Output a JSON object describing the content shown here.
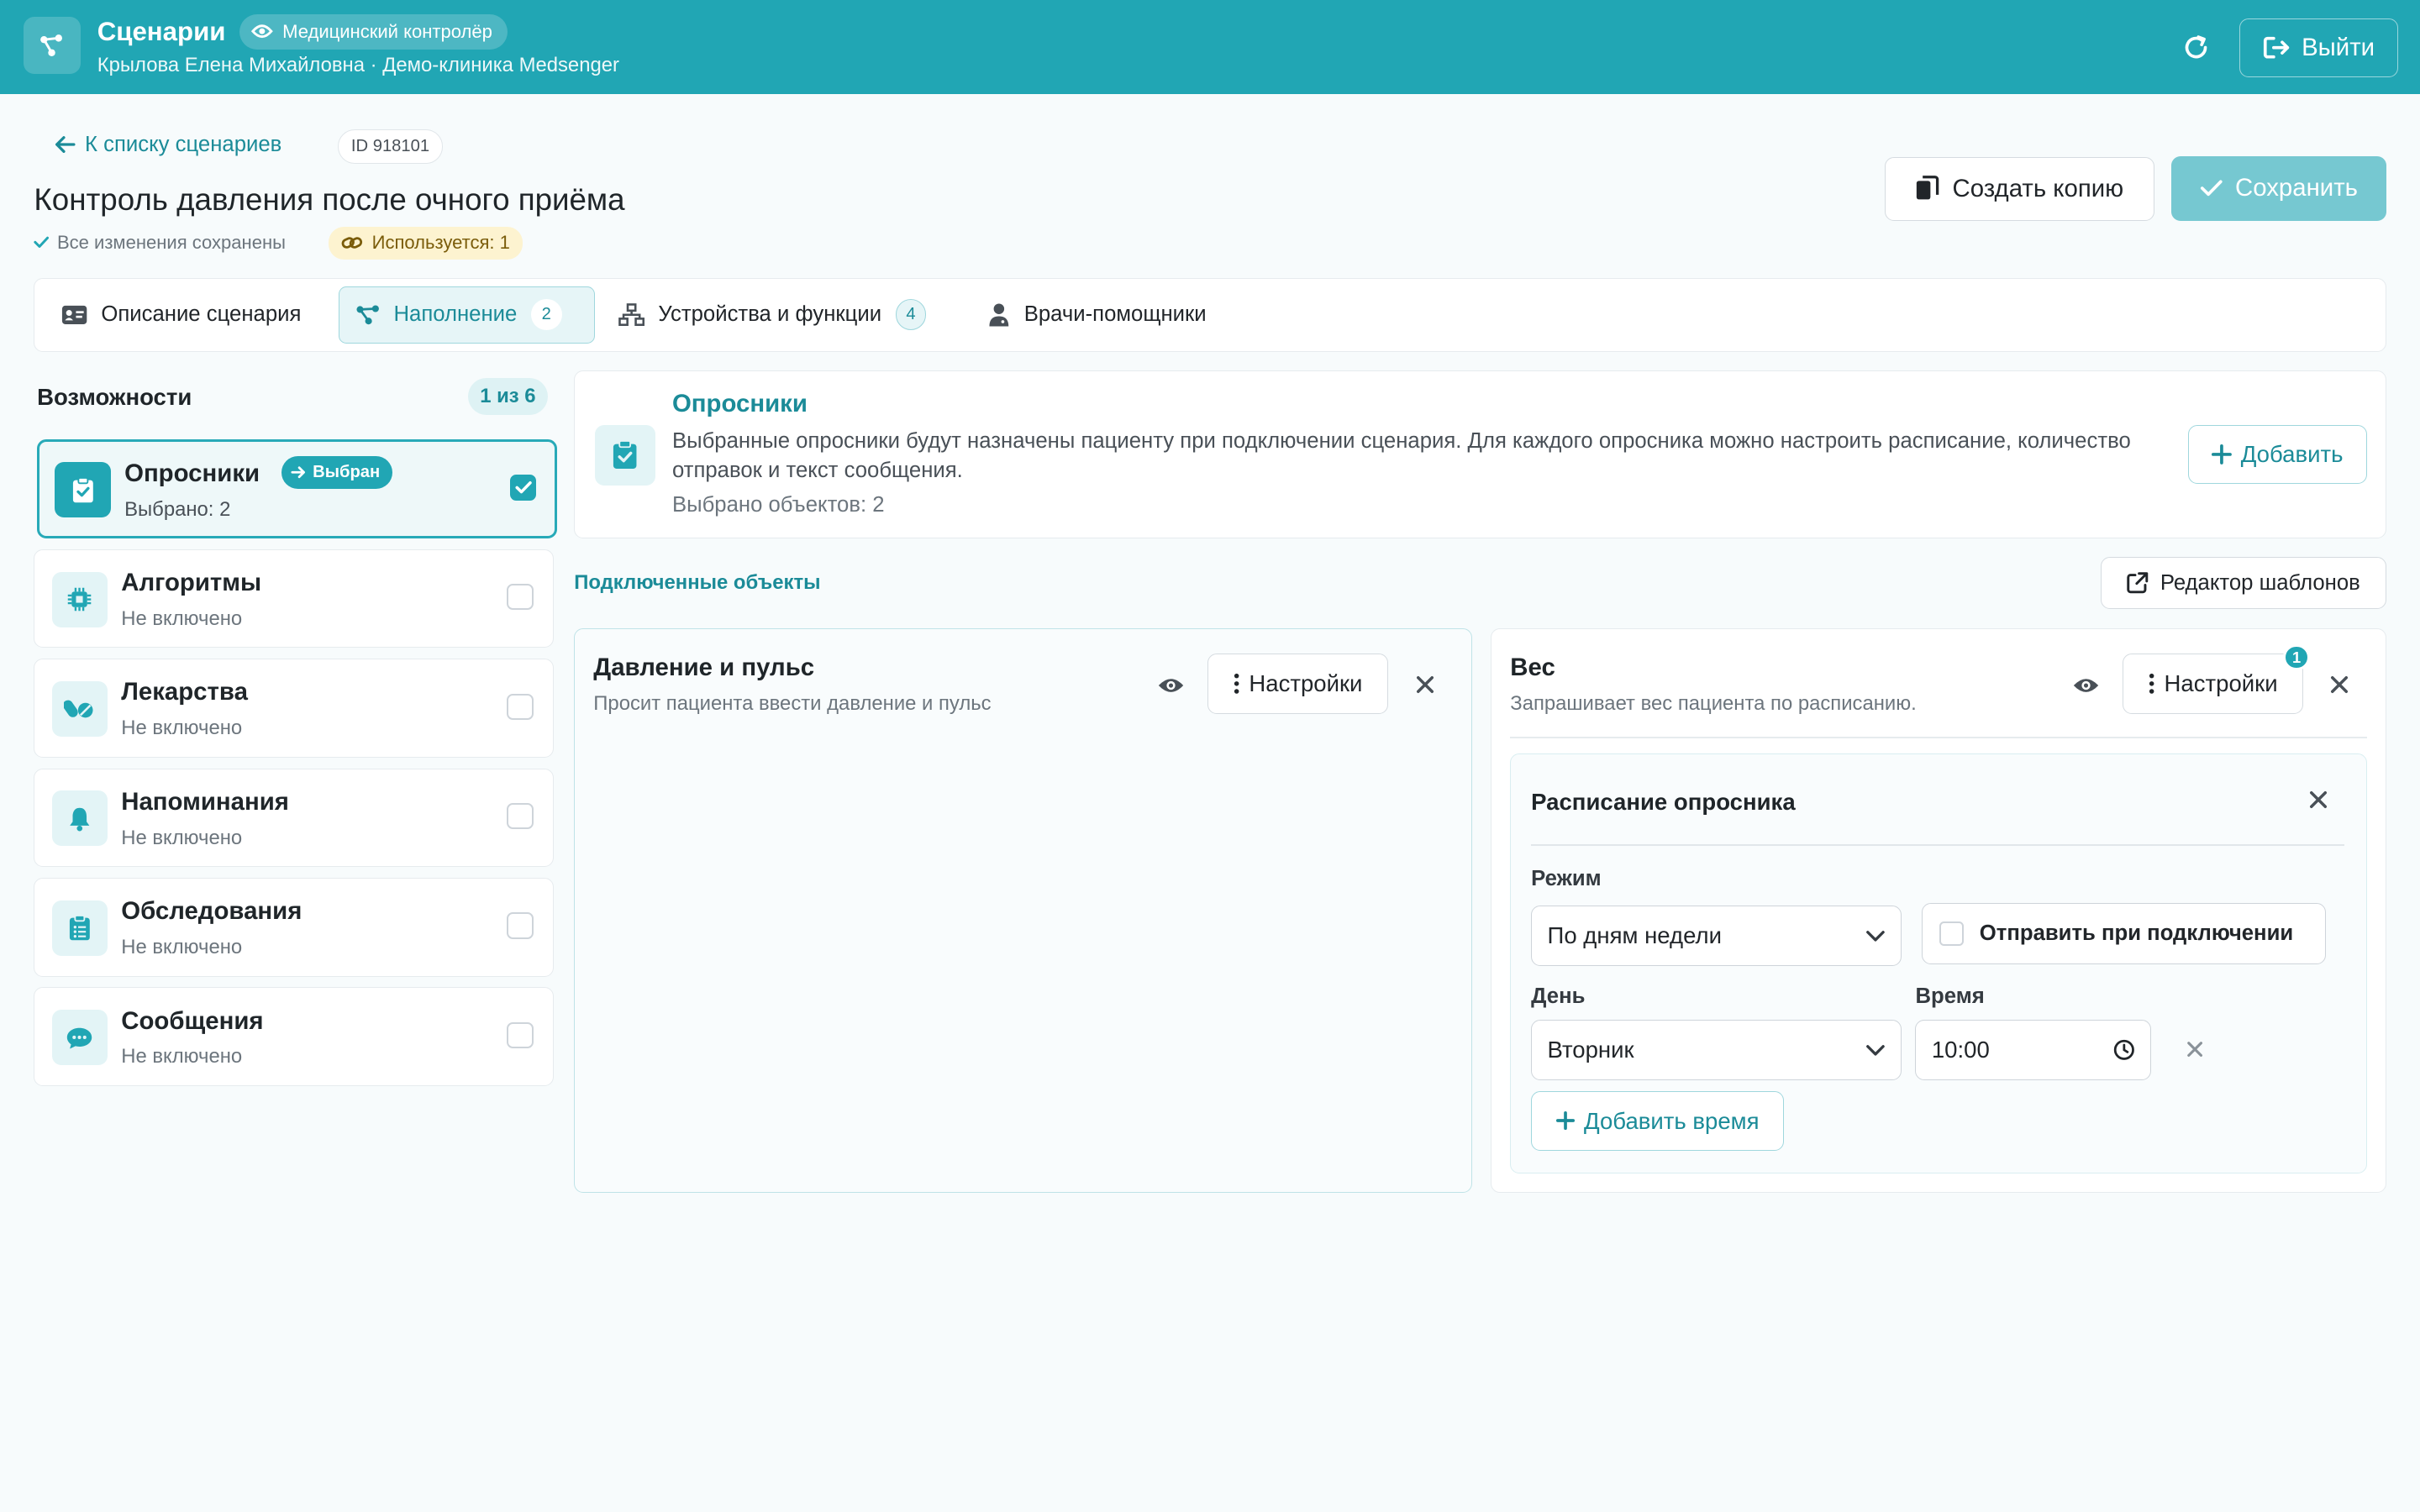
{
  "header": {
    "title": "Сценарии",
    "role": "Медицинский контролёр",
    "user_line": "Крылова Елена Михайловна · Демо-клиника Medsenger",
    "logout_label": "Выйти"
  },
  "page": {
    "back_label": "К списку сценариев",
    "id_label": "ID 918101",
    "title": "Контроль давления после очного приёма",
    "saved_status": "Все изменения сохранены",
    "usage_label": "Используется: 1",
    "copy_label": "Создать копию",
    "save_label": "Сохранить"
  },
  "tabs": [
    {
      "label": "Описание сценария"
    },
    {
      "label": "Наполнение",
      "count": "2"
    },
    {
      "label": "Устройства и функции",
      "count": "4"
    },
    {
      "label": "Врачи-помощники"
    }
  ],
  "capabilities": {
    "title": "Возможности",
    "count": "1 из 6",
    "selected_badge": "Выбран",
    "items": [
      {
        "name": "Опросники",
        "status": "Выбрано: 2",
        "icon": "clipboard-check-icon"
      },
      {
        "name": "Алгоритмы",
        "status": "Не включено",
        "icon": "chip-icon"
      },
      {
        "name": "Лекарства",
        "status": "Не включено",
        "icon": "pills-icon"
      },
      {
        "name": "Напоминания",
        "status": "Не включено",
        "icon": "bell-icon"
      },
      {
        "name": "Обследования",
        "status": "Не включено",
        "icon": "clipboard-list-icon"
      },
      {
        "name": "Сообщения",
        "status": "Не включено",
        "icon": "chat-icon"
      }
    ]
  },
  "info": {
    "title": "Опросники",
    "description": "Выбранные опросники будут назначены пациенту при подключении сценария. Для каждого опросника можно настроить расписание, количество отправок и текст сообщения.",
    "count": "Выбрано объектов: 2",
    "add_label": "Добавить"
  },
  "connected": {
    "label": "Подключенные объекты",
    "template_editor": "Редактор шаблонов"
  },
  "objects": [
    {
      "name": "Давление и пульс",
      "description": "Просит пациента ввести давление и пульс",
      "settings_label": "Настройки"
    },
    {
      "name": "Вес",
      "description": "Запрашивает вес пациента по расписанию.",
      "settings_label": "Настройки",
      "notification": "1"
    }
  ],
  "schedule": {
    "title": "Расписание опросника",
    "mode_label": "Режим",
    "mode_value": "По дням недели",
    "send_on_connect": "Отправить при подключении",
    "day_label": "День",
    "day_value": "Вторник",
    "time_label": "Время",
    "time_value": "10:00",
    "add_time_label": "Добавить время"
  },
  "colors": {
    "brand": "#21a6b4",
    "accent_text": "#1b8b98",
    "usage_bg": "#fdf3d0"
  }
}
